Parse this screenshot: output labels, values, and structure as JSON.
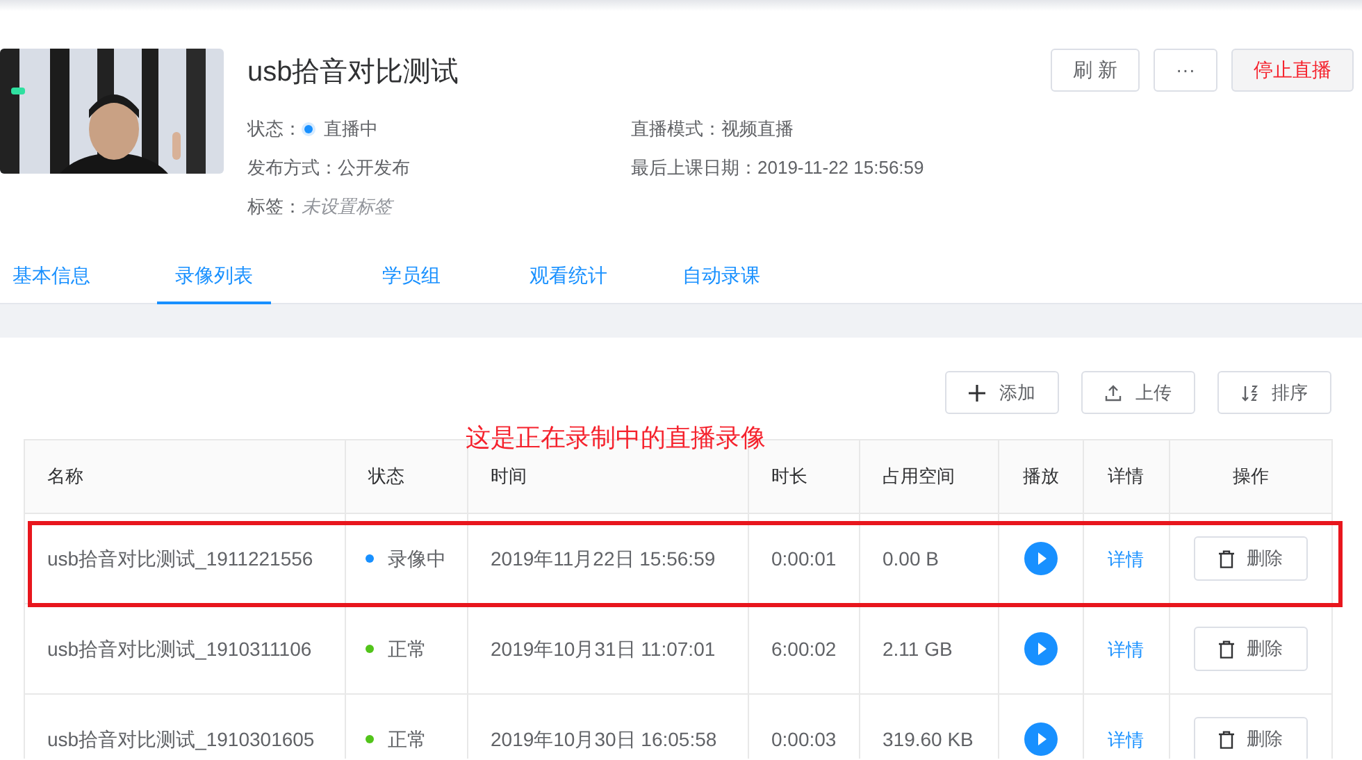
{
  "course": {
    "title": "usb拾音对比测试",
    "info": [
      {
        "label": "状态：",
        "value": "直播中",
        "color": "#1890ff"
      },
      {
        "label": "直播模式：",
        "value": "视频直播"
      },
      {
        "label": "发布方式：",
        "value": "公开发布"
      },
      {
        "label": "最后上课日期：",
        "value": "2019-11-22 15:56:59"
      },
      {
        "label": "标签：",
        "value": "未设置标签",
        "italic": true
      }
    ]
  },
  "header_buttons": [
    {
      "label": "刷 新",
      "kind": "default"
    },
    {
      "label": "···",
      "kind": "default"
    },
    {
      "label": "停止直播",
      "kind": "danger"
    }
  ],
  "tabs": [
    {
      "label": "基本信息",
      "selected": false
    },
    {
      "label": "录像列表",
      "selected": true
    },
    {
      "label": "学员组",
      "selected": false
    },
    {
      "label": "观看统计",
      "selected": false
    },
    {
      "label": "自动录课",
      "selected": false
    }
  ],
  "toolbar": [
    {
      "label": "添加"
    },
    {
      "label": "上传"
    },
    {
      "label": "排序"
    }
  ],
  "annotation": "这是正在录制中的直播录像",
  "table": {
    "columns": [
      "名称",
      "状态",
      "时间",
      "时长",
      "占用空间",
      "播放",
      "详情",
      "操作"
    ],
    "rows": [
      {
        "name": "usb拾音对比测试_1911221556",
        "status": "录像中",
        "color": "#1890ff",
        "time": "2019年11月22日 15:56:59",
        "duration": "0:00:01",
        "size": "0.00 B",
        "detail": "详情",
        "action": "删除",
        "highlighted": true
      },
      {
        "name": "usb拾音对比测试_1910311106",
        "status": "正常",
        "color": "#52c41a",
        "time": "2019年10月31日 11:07:01",
        "duration": "6:00:02",
        "size": "2.11 GB",
        "detail": "详情",
        "action": "删除",
        "highlighted": false
      },
      {
        "name": "usb拾音对比测试_1910301605",
        "status": "正常",
        "color": "#52c41a",
        "time": "2019年10月30日 16:05:58",
        "duration": "0:00:03",
        "size": "319.60 KB",
        "detail": "详情",
        "action": "删除",
        "highlighted": false
      }
    ]
  }
}
